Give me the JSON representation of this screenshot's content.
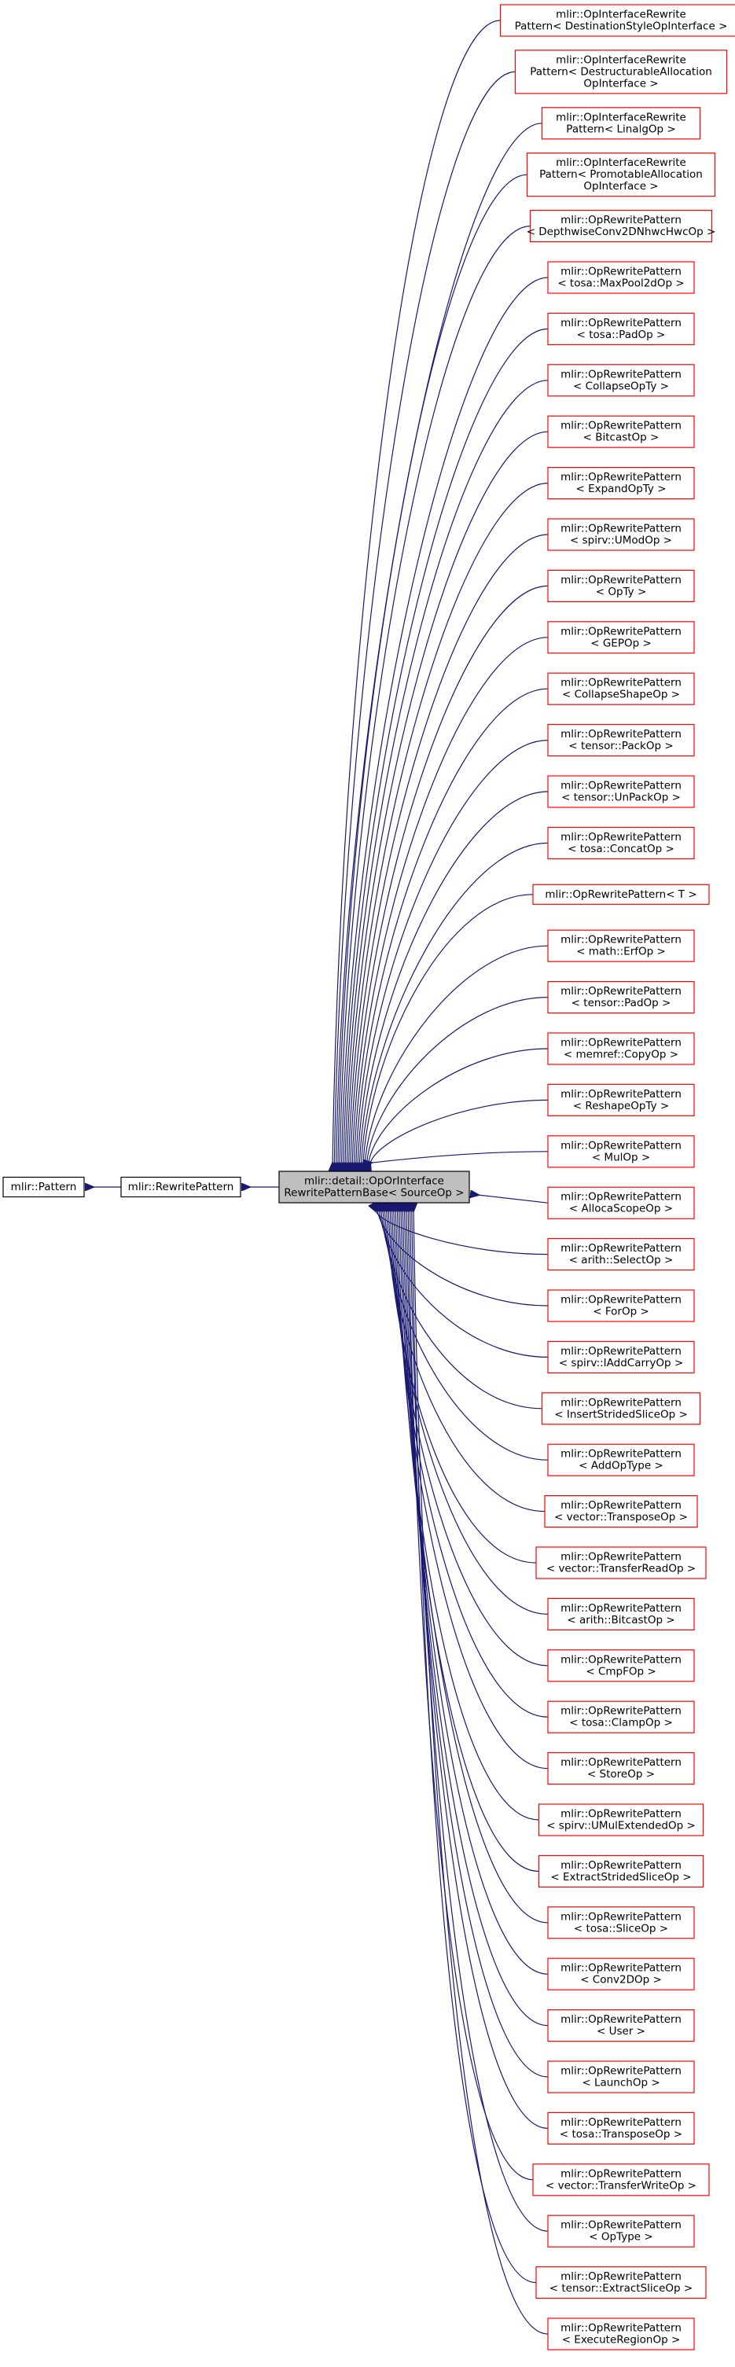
{
  "colors": {
    "edge": "#191970",
    "child_border": "#ff0000",
    "base_border": "#000000",
    "focus_fill": "#bfbfbf",
    "node_fill": "#ffffff"
  },
  "base_nodes": [
    {
      "id": "pattern",
      "lines": [
        "mlir::Pattern"
      ]
    },
    {
      "id": "rewrite-pattern",
      "lines": [
        "mlir::RewritePattern"
      ]
    }
  ],
  "focus_node": {
    "id": "op-or-interface-base",
    "lines": [
      "mlir::detail::OpOrInterface",
      "RewritePatternBase< SourceOp >"
    ]
  },
  "children": [
    {
      "lines": [
        "mlir::OpInterfaceRewrite",
        "Pattern< DestinationStyleOpInterface >"
      ]
    },
    {
      "lines": [
        "mlir::OpInterfaceRewrite",
        "Pattern< DestructurableAllocation",
        "OpInterface >"
      ]
    },
    {
      "lines": [
        "mlir::OpInterfaceRewrite",
        "Pattern< LinalgOp >"
      ]
    },
    {
      "lines": [
        "mlir::OpInterfaceRewrite",
        "Pattern< PromotableAllocation",
        "OpInterface >"
      ]
    },
    {
      "lines": [
        "mlir::OpRewritePattern",
        "< DepthwiseConv2DNhwcHwcOp >"
      ]
    },
    {
      "lines": [
        "mlir::OpRewritePattern",
        "< tosa::MaxPool2dOp >"
      ]
    },
    {
      "lines": [
        "mlir::OpRewritePattern",
        "< tosa::PadOp >"
      ]
    },
    {
      "lines": [
        "mlir::OpRewritePattern",
        "< CollapseOpTy >"
      ]
    },
    {
      "lines": [
        "mlir::OpRewritePattern",
        "< BitcastOp >"
      ]
    },
    {
      "lines": [
        "mlir::OpRewritePattern",
        "< ExpandOpTy >"
      ]
    },
    {
      "lines": [
        "mlir::OpRewritePattern",
        "< spirv::UModOp >"
      ]
    },
    {
      "lines": [
        "mlir::OpRewritePattern",
        "< OpTy >"
      ]
    },
    {
      "lines": [
        "mlir::OpRewritePattern",
        "< GEPOp >"
      ]
    },
    {
      "lines": [
        "mlir::OpRewritePattern",
        "< CollapseShapeOp >"
      ]
    },
    {
      "lines": [
        "mlir::OpRewritePattern",
        "< tensor::PackOp >"
      ]
    },
    {
      "lines": [
        "mlir::OpRewritePattern",
        "< tensor::UnPackOp >"
      ]
    },
    {
      "lines": [
        "mlir::OpRewritePattern",
        "< tosa::ConcatOp >"
      ]
    },
    {
      "lines": [
        "mlir::OpRewritePattern< T >"
      ]
    },
    {
      "lines": [
        "mlir::OpRewritePattern",
        "< math::ErfOp >"
      ]
    },
    {
      "lines": [
        "mlir::OpRewritePattern",
        "< tensor::PadOp >"
      ]
    },
    {
      "lines": [
        "mlir::OpRewritePattern",
        "< memref::CopyOp >"
      ]
    },
    {
      "lines": [
        "mlir::OpRewritePattern",
        "< ReshapeOpTy >"
      ]
    },
    {
      "lines": [
        "mlir::OpRewritePattern",
        "< MulOp >"
      ]
    },
    {
      "lines": [
        "mlir::OpRewritePattern",
        "< AllocaScopeOp >"
      ]
    },
    {
      "lines": [
        "mlir::OpRewritePattern",
        "< arith::SelectOp >"
      ]
    },
    {
      "lines": [
        "mlir::OpRewritePattern",
        "< ForOp >"
      ]
    },
    {
      "lines": [
        "mlir::OpRewritePattern",
        "< spirv::IAddCarryOp >"
      ]
    },
    {
      "lines": [
        "mlir::OpRewritePattern",
        "< InsertStridedSliceOp >"
      ]
    },
    {
      "lines": [
        "mlir::OpRewritePattern",
        "< AddOpType >"
      ]
    },
    {
      "lines": [
        "mlir::OpRewritePattern",
        "< vector::TransposeOp >"
      ]
    },
    {
      "lines": [
        "mlir::OpRewritePattern",
        "< vector::TransferReadOp >"
      ]
    },
    {
      "lines": [
        "mlir::OpRewritePattern",
        "< arith::BitcastOp >"
      ]
    },
    {
      "lines": [
        "mlir::OpRewritePattern",
        "< CmpFOp >"
      ]
    },
    {
      "lines": [
        "mlir::OpRewritePattern",
        "< tosa::ClampOp >"
      ]
    },
    {
      "lines": [
        "mlir::OpRewritePattern",
        "< StoreOp >"
      ]
    },
    {
      "lines": [
        "mlir::OpRewritePattern",
        "< spirv::UMulExtendedOp >"
      ]
    },
    {
      "lines": [
        "mlir::OpRewritePattern",
        "< ExtractStridedSliceOp >"
      ]
    },
    {
      "lines": [
        "mlir::OpRewritePattern",
        "< tosa::SliceOp >"
      ]
    },
    {
      "lines": [
        "mlir::OpRewritePattern",
        "< Conv2DOp >"
      ]
    },
    {
      "lines": [
        "mlir::OpRewritePattern",
        "< User >"
      ]
    },
    {
      "lines": [
        "mlir::OpRewritePattern",
        "< LaunchOp >"
      ]
    },
    {
      "lines": [
        "mlir::OpRewritePattern",
        "< tosa::TransposeOp >"
      ]
    },
    {
      "lines": [
        "mlir::OpRewritePattern",
        "< vector::TransferWriteOp >"
      ]
    },
    {
      "lines": [
        "mlir::OpRewritePattern",
        "< OpType >"
      ]
    },
    {
      "lines": [
        "mlir::OpRewritePattern",
        "< tensor::ExtractSliceOp >"
      ]
    },
    {
      "lines": [
        "mlir::OpRewritePattern",
        "< ExecuteRegionOp >"
      ]
    }
  ]
}
